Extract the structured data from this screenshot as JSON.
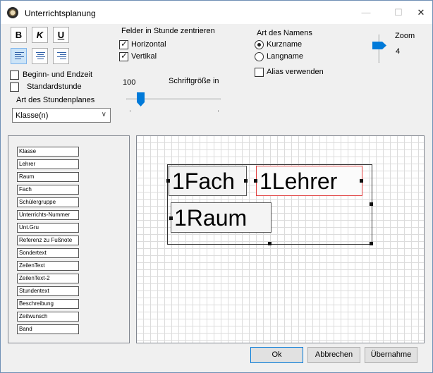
{
  "window": {
    "title": "Unterrichtsplanung"
  },
  "format": {
    "bold": "B",
    "italic": "K",
    "underline": "U"
  },
  "options": {
    "begin_end": "Beginn- und Endzeit",
    "standard": "Standardstunde",
    "plan_type_label": "Art des Stundenplanes",
    "plan_type_value": "Klasse(n)"
  },
  "center": {
    "group_label": "Felder in Stunde zentrieren",
    "horizontal": "Horizontal",
    "vertical": "Vertikal"
  },
  "fontsize": {
    "value": "100",
    "label": "Schriftgröße in"
  },
  "names": {
    "group_label": "Art des Namens",
    "short": "Kurzname",
    "long": "Langname",
    "alias": "Alias verwenden"
  },
  "zoom": {
    "label": "Zoom",
    "value": "4"
  },
  "fields": [
    "Klasse",
    "Lehrer",
    "Raum",
    "Fach",
    "Schülergruppe",
    "Unterrichts-Nummer",
    "Unt.Gru",
    "Referenz zu Fußnote",
    "Sondertext",
    "ZeilenText",
    "ZeilenText-2",
    "Stundentext",
    "Beschreibung",
    "Zeitwunsch",
    "Band"
  ],
  "canvas": {
    "cell1": "1Fach",
    "cell2": "1Lehrer",
    "cell3": "1Raum"
  },
  "buttons": {
    "ok": "Ok",
    "cancel": "Abbrechen",
    "apply": "Übernahme"
  }
}
